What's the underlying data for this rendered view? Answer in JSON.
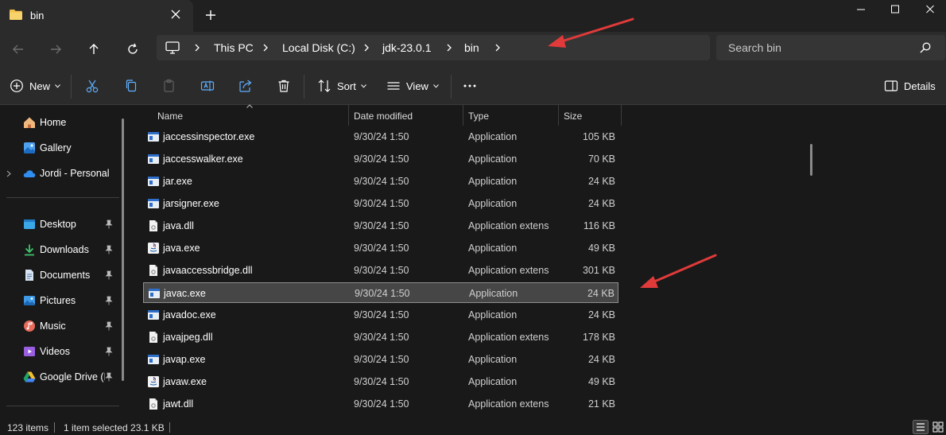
{
  "tab": {
    "title": "bin"
  },
  "address": {
    "crumbs": [
      "This PC",
      "Local Disk (C:)",
      "jdk-23.0.1",
      "bin"
    ]
  },
  "search": {
    "placeholder": "Search bin"
  },
  "toolbar": {
    "new_label": "New",
    "sort_label": "Sort",
    "view_label": "View",
    "details_label": "Details"
  },
  "sidebar": {
    "items": [
      {
        "label": "Home",
        "icon": "home-icon"
      },
      {
        "label": "Gallery",
        "icon": "gallery-icon"
      },
      {
        "label": "Jordi - Personal",
        "icon": "onedrive-icon"
      },
      {
        "label": "Desktop",
        "icon": "desktop-icon"
      },
      {
        "label": "Downloads",
        "icon": "downloads-icon"
      },
      {
        "label": "Documents",
        "icon": "documents-icon"
      },
      {
        "label": "Pictures",
        "icon": "pictures-icon"
      },
      {
        "label": "Music",
        "icon": "music-icon"
      },
      {
        "label": "Videos",
        "icon": "videos-icon"
      },
      {
        "label": "Google Drive (D:)",
        "icon": "google-drive-icon"
      }
    ]
  },
  "columns": {
    "name": "Name",
    "date": "Date modified",
    "type": "Type",
    "size": "Size"
  },
  "files": [
    {
      "name": "jaccessinspector.exe",
      "date": "9/30/24 1:50",
      "type": "Application",
      "size": "105 KB",
      "icon": "exe"
    },
    {
      "name": "jaccesswalker.exe",
      "date": "9/30/24 1:50",
      "type": "Application",
      "size": "70 KB",
      "icon": "exe"
    },
    {
      "name": "jar.exe",
      "date": "9/30/24 1:50",
      "type": "Application",
      "size": "24 KB",
      "icon": "exe"
    },
    {
      "name": "jarsigner.exe",
      "date": "9/30/24 1:50",
      "type": "Application",
      "size": "24 KB",
      "icon": "exe"
    },
    {
      "name": "java.dll",
      "date": "9/30/24 1:50",
      "type": "Application extension",
      "size": "116 KB",
      "icon": "dll"
    },
    {
      "name": "java.exe",
      "date": "9/30/24 1:50",
      "type": "Application",
      "size": "49 KB",
      "icon": "java"
    },
    {
      "name": "javaaccessbridge.dll",
      "date": "9/30/24 1:50",
      "type": "Application extension",
      "size": "301 KB",
      "icon": "dll"
    },
    {
      "name": "javac.exe",
      "date": "9/30/24 1:50",
      "type": "Application",
      "size": "24 KB",
      "icon": "exe",
      "selected": true
    },
    {
      "name": "javadoc.exe",
      "date": "9/30/24 1:50",
      "type": "Application",
      "size": "24 KB",
      "icon": "exe"
    },
    {
      "name": "javajpeg.dll",
      "date": "9/30/24 1:50",
      "type": "Application extension",
      "size": "178 KB",
      "icon": "dll"
    },
    {
      "name": "javap.exe",
      "date": "9/30/24 1:50",
      "type": "Application",
      "size": "24 KB",
      "icon": "exe"
    },
    {
      "name": "javaw.exe",
      "date": "9/30/24 1:50",
      "type": "Application",
      "size": "49 KB",
      "icon": "java"
    },
    {
      "name": "jawt.dll",
      "date": "9/30/24 1:50",
      "type": "Application extension",
      "size": "21 KB",
      "icon": "dll"
    }
  ],
  "status": {
    "item_count": "123 items",
    "selection": "1 item selected  23.1 KB"
  },
  "colors": {
    "background": "#191919",
    "toolbar": "#2b2b2b",
    "address_field": "#353535",
    "selection": "#464646",
    "annotation_arrow": "#e03a3a",
    "folder": "#f3c24e",
    "delete_icon": "#ffffff"
  }
}
